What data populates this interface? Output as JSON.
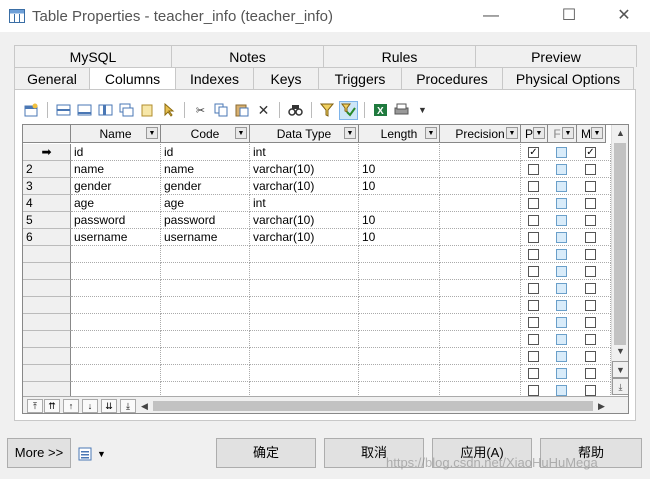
{
  "window": {
    "title": "Table Properties - teacher_info (teacher_info)",
    "minimize": "—",
    "maximize": "☐",
    "close": "✕"
  },
  "tabs_row1": [
    "MySQL",
    "Notes",
    "Rules",
    "Preview"
  ],
  "tabs_row2": [
    "General",
    "Columns",
    "Indexes",
    "Keys",
    "Triggers",
    "Procedures",
    "Physical Options"
  ],
  "active_tab": "Columns",
  "toolbar_icons": [
    "properties-icon",
    "insert-row-icon",
    "add-row-icon",
    "add-columns-icon",
    "copy-row-icon",
    "rename-icon",
    "cut-icon",
    "copy-icon",
    "paste-icon",
    "delete-icon",
    "find-icon",
    "filter-icon",
    "customize-columns-icon",
    "excel-icon",
    "print-icon"
  ],
  "grid": {
    "headers": [
      "Name",
      "Code",
      "Data Type",
      "Length",
      "Precision",
      "P",
      "F",
      "M"
    ],
    "rows": [
      {
        "no": "➡",
        "name": "id",
        "code": "id",
        "type": "int",
        "length": "",
        "precision": "",
        "p": true,
        "f": false,
        "m": true
      },
      {
        "no": "2",
        "name": "name",
        "code": "name",
        "type": "varchar(10)",
        "length": "10",
        "precision": "",
        "p": false,
        "f": false,
        "m": false
      },
      {
        "no": "3",
        "name": "gender",
        "code": "gender",
        "type": "varchar(10)",
        "length": "10",
        "precision": "",
        "p": false,
        "f": false,
        "m": false
      },
      {
        "no": "4",
        "name": "age",
        "code": "age",
        "type": "int",
        "length": "",
        "precision": "",
        "p": false,
        "f": false,
        "m": false
      },
      {
        "no": "5",
        "name": "password",
        "code": "password",
        "type": "varchar(10)",
        "length": "10",
        "precision": "",
        "p": false,
        "f": false,
        "m": false
      },
      {
        "no": "6",
        "name": "username",
        "code": "username",
        "type": "varchar(10)",
        "length": "10",
        "precision": "",
        "p": false,
        "f": false,
        "m": false
      }
    ],
    "empty_rows": 9,
    "check_mark": "☑"
  },
  "nav_buttons": [
    "⤒",
    "⇈",
    "↑",
    "↓",
    "⇊",
    "⤓"
  ],
  "buttons": {
    "more": "More >>",
    "ok": "确定",
    "cancel": "取消",
    "apply": "应用(A)",
    "help": "帮助"
  },
  "watermark": "https://blog.csdn.net/XiaoHuHuMega"
}
